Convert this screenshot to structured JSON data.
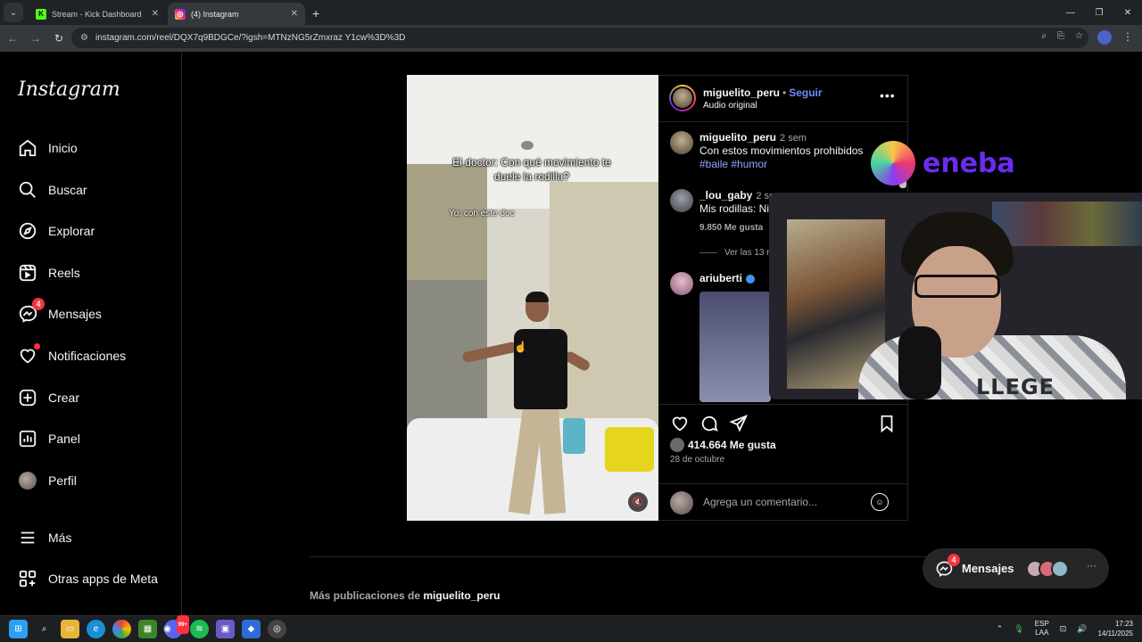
{
  "browser": {
    "tabs": [
      {
        "title": "Stream - Kick Dashboard",
        "active": false,
        "favicon_color": "#53fc18"
      },
      {
        "title": "(4) Instagram",
        "active": true,
        "favicon_color": "#e1306c"
      }
    ],
    "url": "instagram.com/reel/DQX7q9BDGCe/?igsh=MTNzNG5rZmxraz Y1cw%3D%3D"
  },
  "sidebar": {
    "logo": "Instagram",
    "items": [
      {
        "label": "Inicio",
        "icon": "home-icon"
      },
      {
        "label": "Buscar",
        "icon": "search-icon"
      },
      {
        "label": "Explorar",
        "icon": "compass-icon"
      },
      {
        "label": "Reels",
        "icon": "reels-icon"
      },
      {
        "label": "Mensajes",
        "icon": "messenger-icon",
        "badge": "4"
      },
      {
        "label": "Notificaciones",
        "icon": "heart-icon"
      },
      {
        "label": "Crear",
        "icon": "plus-square-icon"
      },
      {
        "label": "Panel",
        "icon": "dashboard-icon"
      },
      {
        "label": "Perfil",
        "icon": "avatar"
      },
      {
        "label": "Más",
        "icon": "menu-icon"
      },
      {
        "label": "Otras apps de Meta",
        "icon": "apps-icon"
      }
    ]
  },
  "reel": {
    "caption_main": "El doctor: Con qué movimiento te duele la rodilla?",
    "caption_sub": "Yo: con este doc"
  },
  "post": {
    "username": "miguelito_peru",
    "separator": "•",
    "follow": "Seguir",
    "audio": "Audio original",
    "comments": [
      {
        "user": "miguelito_peru",
        "time": "2 sem",
        "text": "Con estos movimientos prohibidos",
        "hashtags": "#baile #humor"
      },
      {
        "user": "_lou_gaby",
        "time": "2 sem",
        "text": "Mis rodillas: Ni",
        "likes": "9.850 Me gusta",
        "replies": "Ver las 13 r"
      },
      {
        "user": "ariuberti",
        "verified": true
      }
    ],
    "likes": "414.664 Me gusta",
    "date": "28 de octubre",
    "comment_placeholder": "Agrega un comentario..."
  },
  "overlay": {
    "sponsor": "eneba",
    "shirt_text": "LLEGE"
  },
  "footer": {
    "more_prefix": "Más publicaciones de",
    "more_user": "miguelito_peru"
  },
  "messages_pill": {
    "label": "Mensajes",
    "badge": "4",
    "more": "···"
  },
  "taskbar": {
    "lang_line1": "ESP",
    "lang_line2": "LAA",
    "time": "17:23",
    "date": "14/11/2025",
    "discord_badge": "99+"
  },
  "colors": {
    "accent_link": "#6e8dfb",
    "hashtag": "#8fa7ff",
    "notification": "#ff3040",
    "eneba": "#6a2cf0"
  }
}
